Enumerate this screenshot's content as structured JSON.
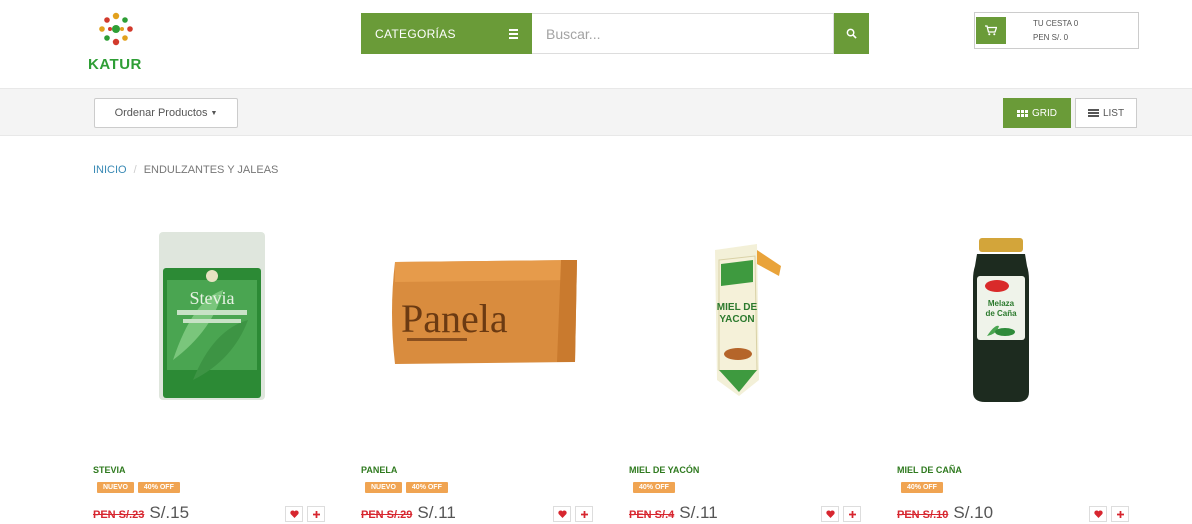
{
  "brand": {
    "name": "KATUR"
  },
  "header": {
    "categories_label": "CATEGORÍAS",
    "search_placeholder": "Buscar...",
    "cart_line1": "TU CESTA 0",
    "cart_line2": "PEN S/. 0"
  },
  "toolbar": {
    "sort_label": "Ordenar Productos",
    "grid_label": "GRID",
    "list_label": "LIST"
  },
  "breadcrumb": {
    "home": "INICIO",
    "separator": "/",
    "current": "ENDULZANTES Y JALEAS"
  },
  "products": [
    {
      "name": "STEVIA",
      "badges": [
        "NUEVO",
        "40% OFF"
      ],
      "old_price": "PEN S/.23",
      "price": "S/.15"
    },
    {
      "name": "PANELA",
      "badges": [
        "NUEVO",
        "40% OFF"
      ],
      "old_price": "PEN S/.29",
      "price": "S/.11"
    },
    {
      "name": "MIEL DE YACÓN",
      "badges": [
        "40% OFF"
      ],
      "old_price": "PEN S/.4",
      "price": "S/.11"
    },
    {
      "name": "MIEL DE CAÑA",
      "badges": [
        "40% OFF"
      ],
      "old_price": "PEN S/.10",
      "price": "S/.10"
    }
  ],
  "icons": {
    "cart": "shopping-cart-icon",
    "search": "search-icon",
    "menu": "menu-icon",
    "heart": "heart-icon",
    "plus": "plus-icon"
  },
  "colors": {
    "primary_green": "#6a9b38",
    "badge_orange": "#f0a452",
    "old_price_red": "#d7262f",
    "link_blue": "#3a8ab5"
  }
}
